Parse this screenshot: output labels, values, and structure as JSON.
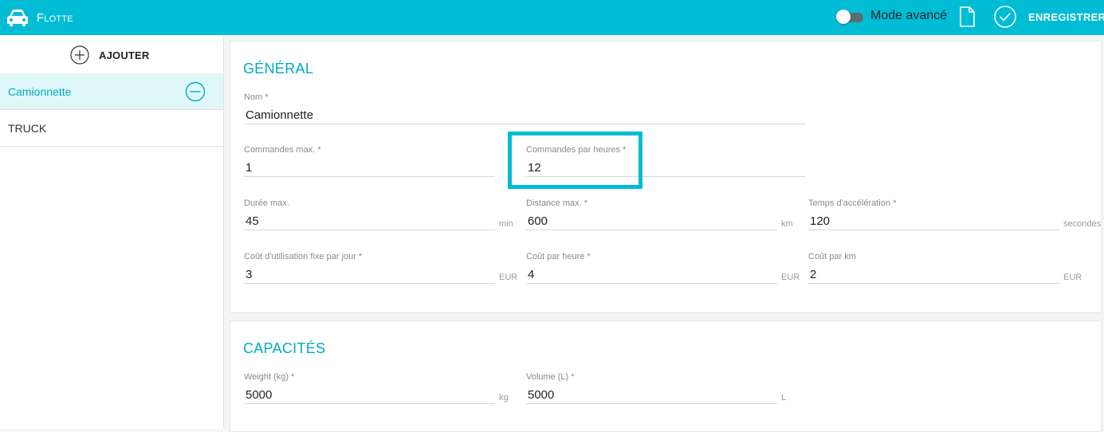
{
  "topbar": {
    "app_icon": "car-icon",
    "title": "Flotte",
    "mode_label": "Mode avancé",
    "mode_enabled": false,
    "doc_icon": "document-icon",
    "save_icon": "check-circle-icon",
    "save_label": "ENREGISTRER"
  },
  "sidebar": {
    "add_label": "AJOUTER",
    "items": [
      {
        "label": "Camionnette",
        "active": true
      },
      {
        "label": "TRUCK",
        "active": false
      }
    ]
  },
  "general": {
    "title": "GÉNÉRAL",
    "nom": {
      "label": "Nom",
      "value": "Camionnette"
    },
    "commandes_max": {
      "label": "Commandes max.",
      "value": "1"
    },
    "commandes_par_heures": {
      "label": "Commandes par heures",
      "value": "12"
    },
    "duree_max": {
      "label": "Durée max.",
      "value": "45",
      "unit": "min"
    },
    "distance_max": {
      "label": "Distance max.",
      "value": "600",
      "unit": "km"
    },
    "temps_acceleration": {
      "label": "Temps d'accélération",
      "value": "120",
      "unit": "secondes"
    },
    "cout_fixe": {
      "label": "Coût d'utilisation fixe par jour",
      "value": "3",
      "unit": "EUR"
    },
    "cout_heure": {
      "label": "Coût par heure",
      "value": "4",
      "unit": "EUR"
    },
    "cout_km": {
      "label": "Coût par km",
      "value": "2",
      "unit": "EUR"
    }
  },
  "capacites": {
    "title": "CAPACITÉS",
    "weight": {
      "label": "Weight (kg)",
      "value": "5000",
      "unit": "kg"
    },
    "volume": {
      "label": "Volume (L)",
      "value": "5000",
      "unit": "L"
    }
  },
  "colors": {
    "accent": "#00bcd4",
    "accent_text": "#00acc1",
    "active_bg": "#e0f7fa"
  },
  "required_marker": "*"
}
